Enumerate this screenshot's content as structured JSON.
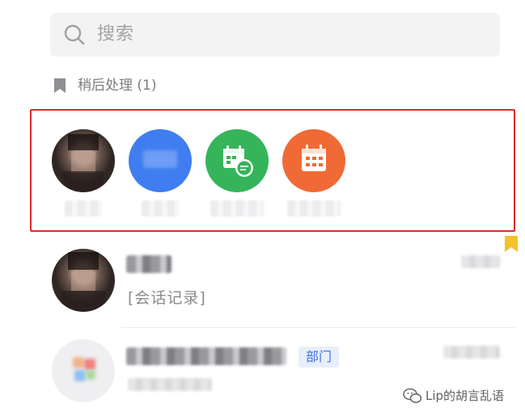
{
  "search": {
    "placeholder": "搜索"
  },
  "later_section": {
    "label": "稍后处理 (1)"
  },
  "pinned": [
    {
      "kind": "contact-avatar"
    },
    {
      "kind": "blue-app",
      "color": "#3f7df0"
    },
    {
      "kind": "calendar-chat-app",
      "color": "#35b45a"
    },
    {
      "kind": "calendar-app",
      "color": "#f06a35"
    }
  ],
  "conversations": [
    {
      "preview": "[会话记录]",
      "flagged": true
    },
    {
      "badge": "部门"
    }
  ],
  "watermark": {
    "text": "Lip的胡言乱语"
  },
  "colors": {
    "highlight_border": "#dc2b2b",
    "flag": "#f5c22a",
    "badge_text": "#3f72d8"
  }
}
